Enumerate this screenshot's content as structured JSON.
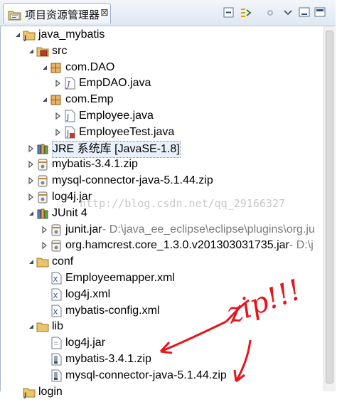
{
  "view": {
    "title": "项目资源管理器",
    "close_glyph": "⊠",
    "toolbar": [
      {
        "name": "collapse-all-icon"
      },
      {
        "name": "link-with-editor-icon"
      },
      {
        "name": "view-menu-icon"
      },
      {
        "name": "minimize-icon"
      },
      {
        "name": "maximize-icon"
      }
    ]
  },
  "tree": [
    {
      "name": "project-java-mybatis",
      "label": "java_mybatis",
      "icon": "project",
      "arrow": "expanded",
      "depth": 0
    },
    {
      "name": "folder-src",
      "label": "src",
      "icon": "source-folder",
      "arrow": "expanded",
      "depth": 1
    },
    {
      "name": "package-com-dao",
      "label": "com.DAO",
      "icon": "package",
      "arrow": "expanded",
      "depth": 2
    },
    {
      "name": "file-empdao-java",
      "label": "EmpDAO.java",
      "icon": "java-interface",
      "arrow": "collapsed",
      "depth": 3
    },
    {
      "name": "package-com-emp",
      "label": "com.Emp",
      "icon": "package",
      "arrow": "expanded",
      "depth": 2
    },
    {
      "name": "file-employee-java",
      "label": "Employee.java",
      "icon": "java-file",
      "arrow": "collapsed",
      "depth": 3
    },
    {
      "name": "file-employeetest-java",
      "label": "EmployeeTest.java",
      "icon": "java-test",
      "arrow": "collapsed",
      "depth": 3
    },
    {
      "name": "lib-jre",
      "label": "JRE 系统库 [JavaSE-1.8]",
      "icon": "library",
      "arrow": "collapsed",
      "depth": 1,
      "selected": true
    },
    {
      "name": "jar-mybatis",
      "label": "mybatis-3.4.1.zip",
      "icon": "jar",
      "arrow": "collapsed",
      "depth": 1
    },
    {
      "name": "jar-mysql-connector",
      "label": "mysql-connector-java-5.1.44.zip",
      "icon": "jar",
      "arrow": "collapsed",
      "depth": 1
    },
    {
      "name": "jar-log4j",
      "label": "log4j.jar",
      "icon": "jar",
      "arrow": "collapsed",
      "depth": 1
    },
    {
      "name": "lib-junit4",
      "label": "JUnit 4",
      "icon": "library",
      "arrow": "expanded",
      "depth": 1
    },
    {
      "name": "jar-junit",
      "label": "junit.jar",
      "decoration": " - D:\\java_ee_eclipse\\eclipse\\plugins\\org.ju",
      "icon": "jar",
      "arrow": "collapsed",
      "depth": 2
    },
    {
      "name": "jar-hamcrest",
      "label": "org.hamcrest.core_1.3.0.v201303031735.jar",
      "decoration": " - D:\\j",
      "icon": "jar",
      "arrow": "collapsed",
      "depth": 2
    },
    {
      "name": "folder-conf",
      "label": "conf",
      "icon": "folder",
      "arrow": "expanded",
      "depth": 1
    },
    {
      "name": "file-employeemapper-xml",
      "label": "Employeemapper.xml",
      "icon": "xml",
      "arrow": "none",
      "depth": 2
    },
    {
      "name": "file-log4j-xml",
      "label": "log4j.xml",
      "icon": "xml",
      "arrow": "none",
      "depth": 2
    },
    {
      "name": "file-mybatis-config-xml",
      "label": "mybatis-config.xml",
      "icon": "xml",
      "arrow": "none",
      "depth": 2
    },
    {
      "name": "folder-lib",
      "label": "lib",
      "icon": "folder",
      "arrow": "expanded",
      "depth": 1
    },
    {
      "name": "file-lib-log4j-jar",
      "label": "log4j.jar",
      "icon": "file",
      "arrow": "none",
      "depth": 2
    },
    {
      "name": "file-lib-mybatis-zip",
      "label": "mybatis-3.4.1.zip",
      "icon": "zip",
      "arrow": "none",
      "depth": 2
    },
    {
      "name": "file-lib-mysql-zip",
      "label": "mysql-connector-java-5.1.44.zip",
      "icon": "zip",
      "arrow": "none",
      "depth": 2
    },
    {
      "name": "project-login",
      "label": "login",
      "icon": "project",
      "arrow": "none",
      "depth": 0
    }
  ],
  "watermark": "http://blog.csdn.net/qq_29166327",
  "annotation": {
    "text": "zip!!!",
    "color": "#e8141b"
  }
}
